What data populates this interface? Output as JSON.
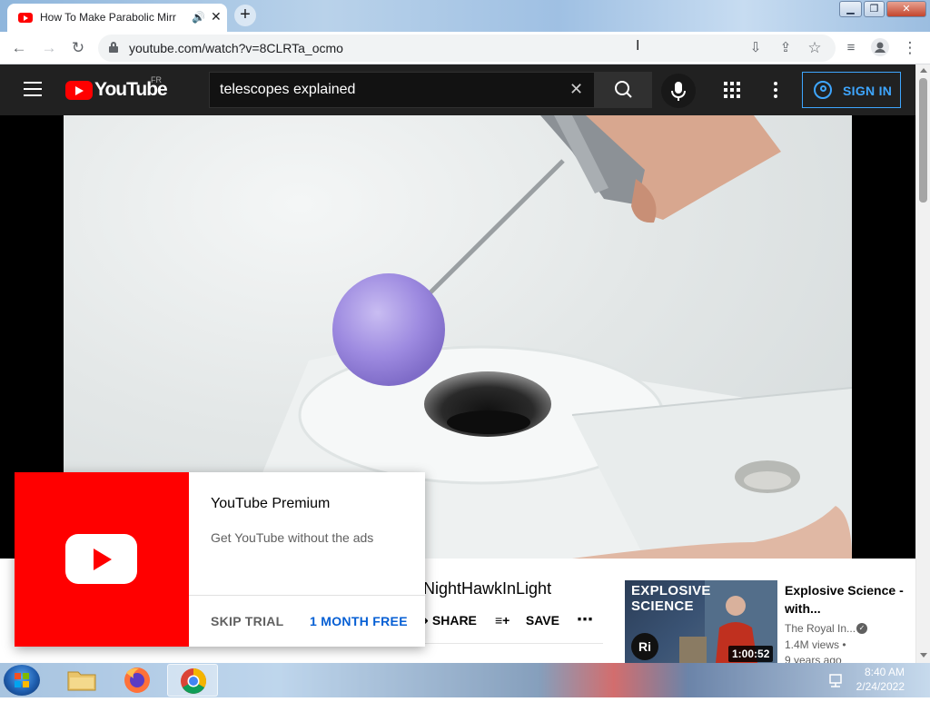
{
  "browser": {
    "tab_title": "How To Make Parabolic Mirr",
    "url": "youtube.com/watch?v=8CLRTa_ocmo"
  },
  "youtube": {
    "logo_text": "YouTube",
    "country_code": "FR",
    "search_value": "telescopes explained",
    "signin_label": "SIGN IN"
  },
  "video": {
    "channel_name": "NightHawkInLight",
    "actions": {
      "share": "SHARE",
      "save": "SAVE"
    }
  },
  "recommended": {
    "thumb_text_line1": "EXPLOSIVE",
    "thumb_text_line2": "SCIENCE",
    "thumb_avatar": "Ri",
    "duration": "1:00:52",
    "title": "Explosive Science - with...",
    "channel": "The Royal In...",
    "views": "1.4M views •",
    "age": "9 years ago"
  },
  "promo": {
    "title": "YouTube Premium",
    "subtitle": "Get YouTube without the ads",
    "skip_label": "SKIP TRIAL",
    "free_label": "1 MONTH FREE"
  },
  "taskbar": {
    "time": "8:40 AM",
    "date": "2/24/2022"
  },
  "colors": {
    "yt_red": "#ff0000",
    "masthead_bg": "#212121",
    "link_blue": "#065fd4",
    "signin_blue": "#3ea6ff"
  }
}
